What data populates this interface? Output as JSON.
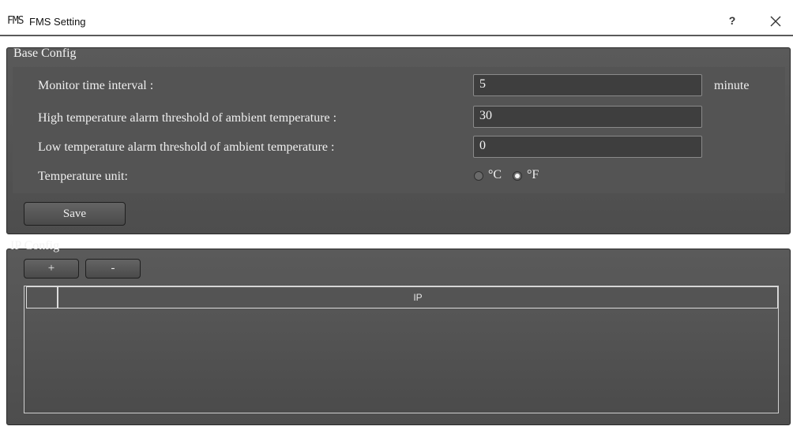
{
  "window": {
    "icon_text": "FMS",
    "title": "FMS Setting",
    "help_label": "?"
  },
  "base_config": {
    "title": "Base Config",
    "monitor_interval_label": "Monitor time interval :",
    "monitor_interval_value": "5",
    "monitor_interval_unit": "minute",
    "high_temp_label": "High temperature alarm threshold of ambient temperature :",
    "high_temp_value": "30",
    "low_temp_label": "Low temperature alarm threshold of ambient temperature :",
    "low_temp_value": "0",
    "temp_unit_label": "Temperature unit:",
    "temp_unit_options": [
      "°C",
      "°F"
    ],
    "temp_unit_selected": "°F",
    "save_label": "Save"
  },
  "ip_config": {
    "title": "IP Config",
    "add_label": "+",
    "remove_label": "-",
    "columns": [
      "",
      "IP"
    ],
    "rows": []
  },
  "colors": {
    "panel_bg": "#555555",
    "field_bg": "#3e3e3e",
    "text": "#efefef"
  }
}
